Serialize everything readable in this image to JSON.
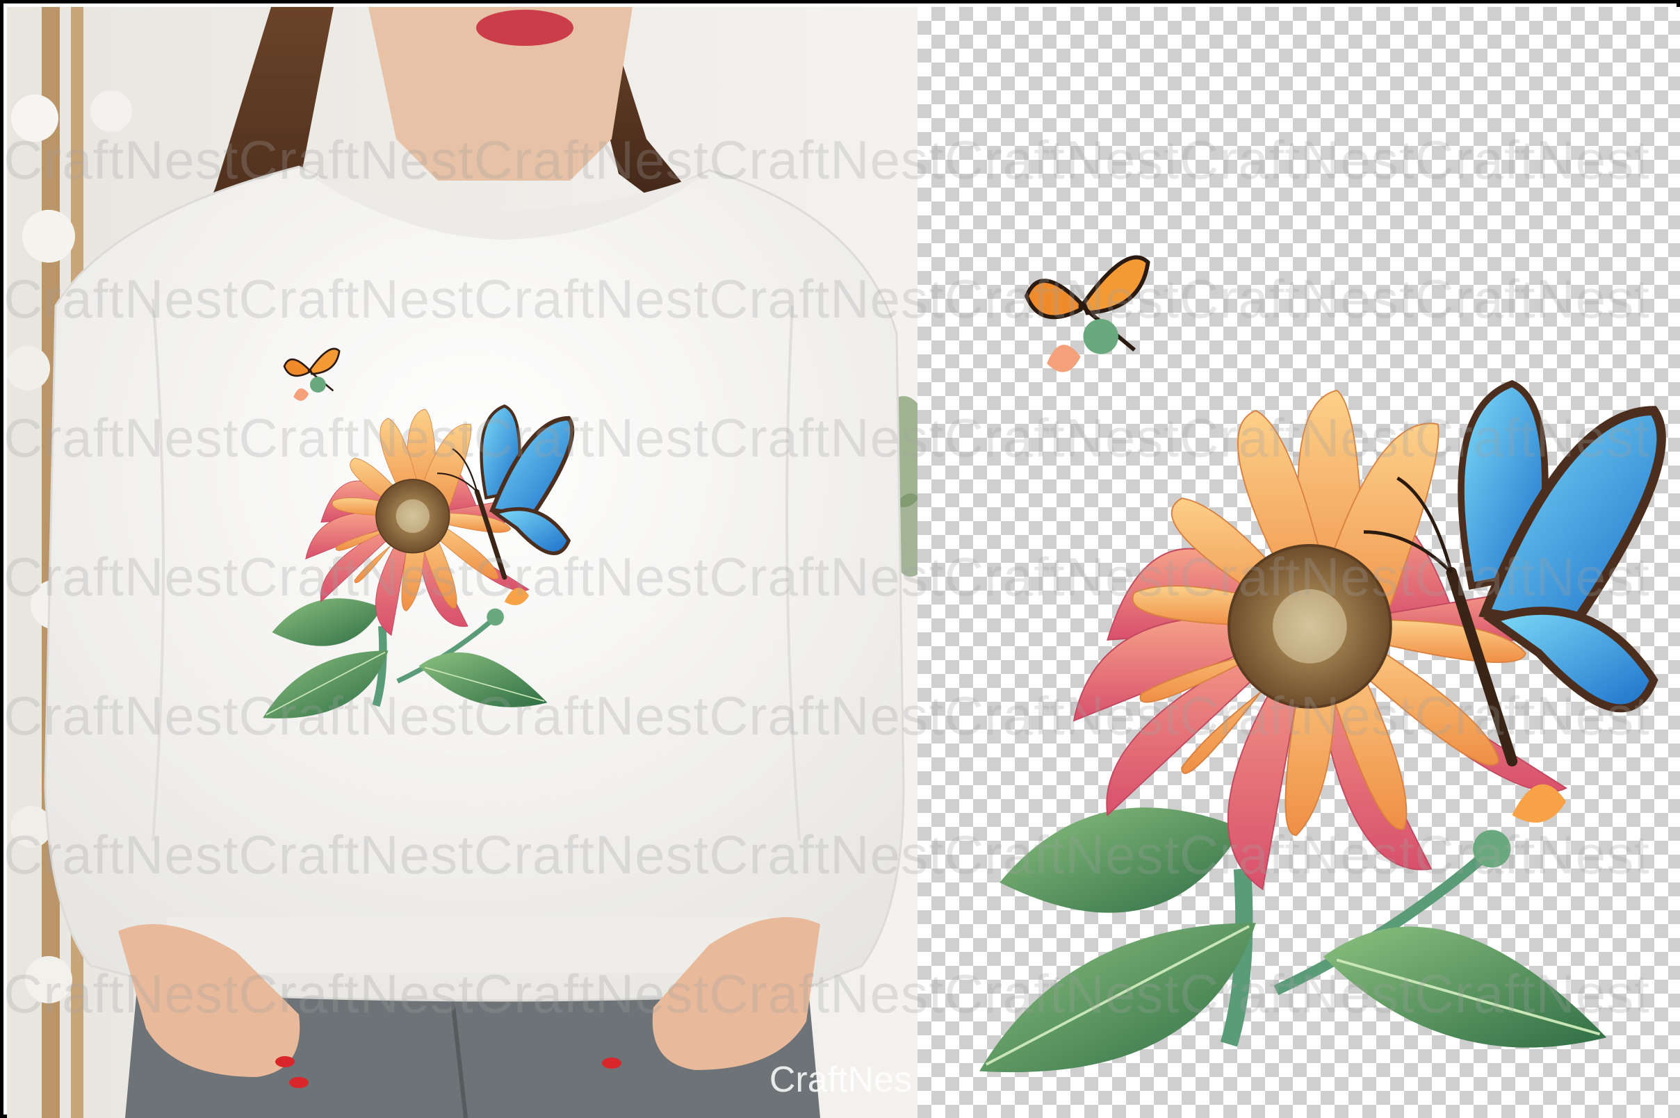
{
  "watermark": {
    "text": "CraftNestCraftNestCraftNestCraftNestCraftNestCraftNestCraftNest",
    "corner_label": "CraftNes"
  },
  "panels": {
    "left": {
      "subject": "woman-wearing-white-sweatshirt-with-print"
    },
    "right": {
      "subject": "flower-and-butterfly-design-on-transparent-background"
    }
  },
  "colors": {
    "sweatshirt": "#f7f6f4",
    "petal_orange": "#f4a45a",
    "petal_pink": "#e56b7d",
    "butterfly_blue": "#2f9fe0",
    "leaf_green": "#4e8f55",
    "flower_center": "#8a6a3f"
  }
}
